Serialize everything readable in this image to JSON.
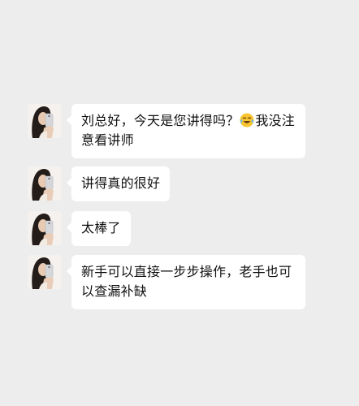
{
  "chat": {
    "messages": [
      {
        "text_before": "刘总好，今天是您讲得吗？",
        "emoji": "laugh-cry-emoji",
        "text_after": "我没注意看讲师"
      },
      {
        "text": "讲得真的很好"
      },
      {
        "text": "太棒了"
      },
      {
        "text": "新手可以直接一步步操作，老手也可以查漏补缺"
      }
    ]
  },
  "colors": {
    "background": "#ededed",
    "bubble": "#ffffff",
    "text": "#111111"
  }
}
